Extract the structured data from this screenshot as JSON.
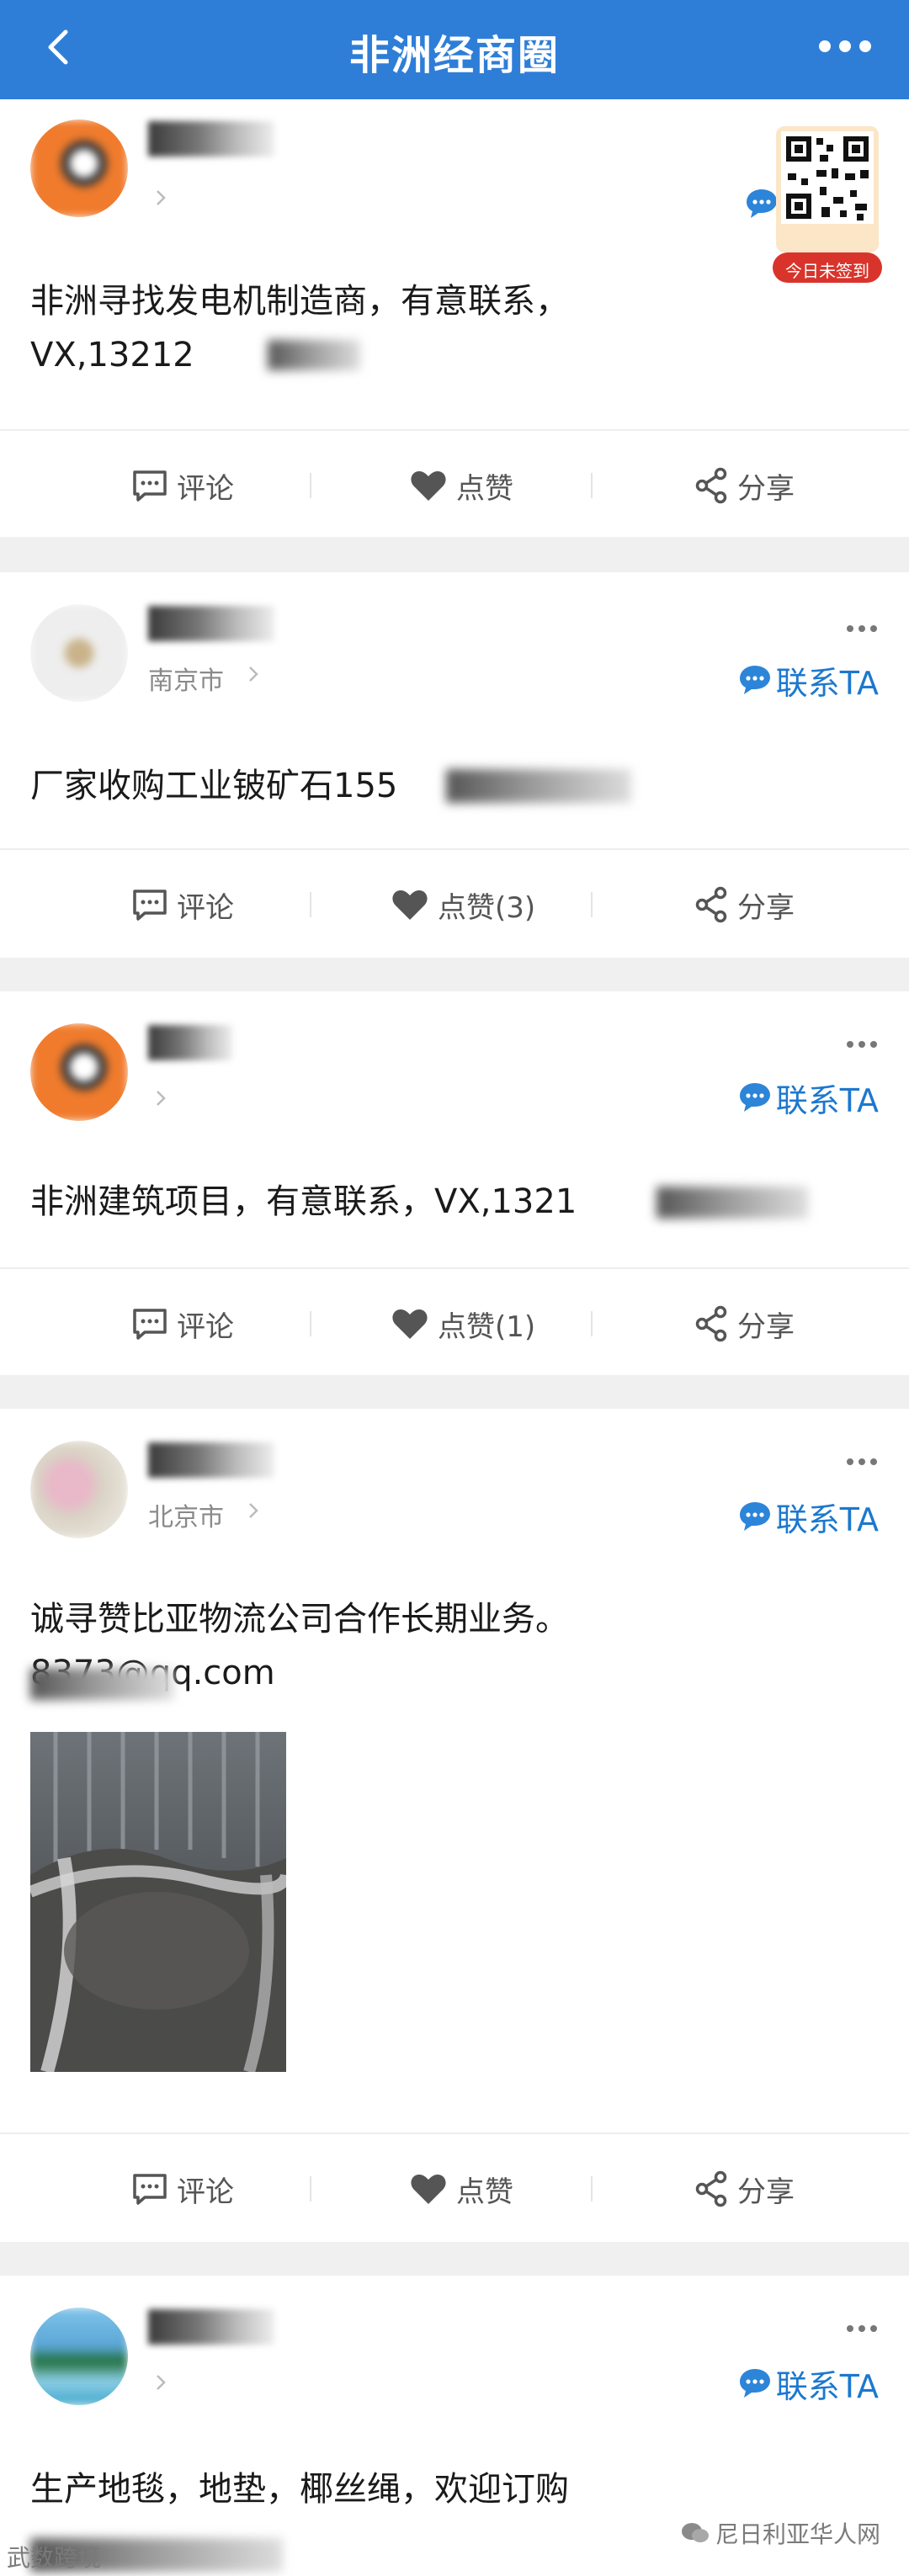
{
  "header": {
    "title": "非洲经商圈"
  },
  "colors": {
    "nav": "#2e7ed8",
    "accent": "#1c78cf",
    "badge": "#d9342b"
  },
  "qr_badge": {
    "label": "今日未签到"
  },
  "actions_labels": {
    "comment": "评论",
    "share": "分享"
  },
  "posts": [
    {
      "location": "",
      "contact": "联系TA",
      "content": "非洲寻找发电机制造商，有意联系，\nVX,13212",
      "like": "点赞"
    },
    {
      "location": "南京市",
      "contact": "联系TA",
      "content": "厂家收购工业铍矿石155",
      "like": "点赞(3)"
    },
    {
      "location": "",
      "contact": "联系TA",
      "content": "非洲建筑项目，有意联系，VX,1321",
      "like": "点赞(1)"
    },
    {
      "location": "北京市",
      "contact": "联系TA",
      "content": "诚寻赞比亚物流公司合作长期业务。\n8373@qq.com",
      "like": "点赞"
    },
    {
      "location": "",
      "contact": "联系TA",
      "content": "生产地毯，地垫，椰丝绳，欢迎订购",
      "like": ""
    }
  ],
  "watermarks": {
    "left": "武数跨境",
    "right": "尼日利亚华人网"
  }
}
